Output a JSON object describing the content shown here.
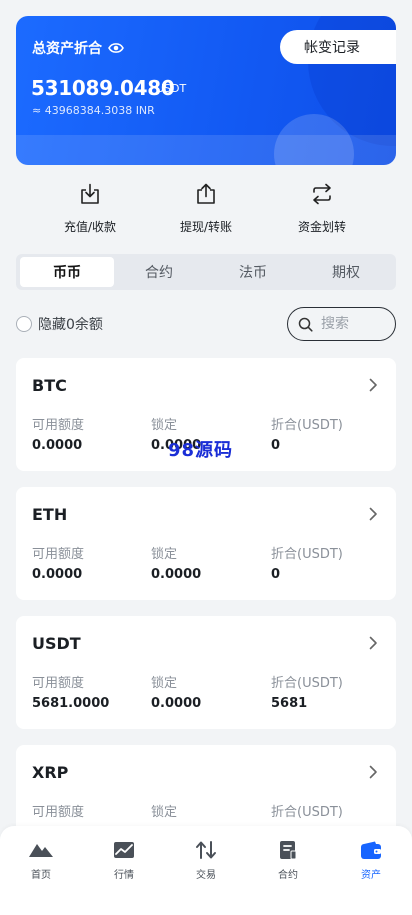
{
  "header": {
    "title": "总资产折合",
    "record_button": "帐变记录",
    "balance": "531089.0480",
    "balance_unit": "USDT",
    "converted": "≈ 43968384.3038 INR",
    "accent_color": "#1765ff"
  },
  "actions": [
    {
      "label": "充值/收款",
      "icon": "download-icon"
    },
    {
      "label": "提现/转账",
      "icon": "upload-icon"
    },
    {
      "label": "资金划转",
      "icon": "transfer-icon"
    }
  ],
  "tabs": [
    {
      "label": "币币",
      "active": true
    },
    {
      "label": "合约",
      "active": false
    },
    {
      "label": "法币",
      "active": false
    },
    {
      "label": "期权",
      "active": false
    }
  ],
  "filter": {
    "hide_zero_label": "隐藏0余额",
    "search_placeholder": "搜索"
  },
  "columns": [
    "可用额度",
    "锁定",
    "折合(USDT)"
  ],
  "assets": [
    {
      "coin": "BTC",
      "available": "0.0000",
      "locked": "0.0000",
      "converted": "0"
    },
    {
      "coin": "ETH",
      "available": "0.0000",
      "locked": "0.0000",
      "converted": "0"
    },
    {
      "coin": "USDT",
      "available": "5681.0000",
      "locked": "0.0000",
      "converted": "5681"
    },
    {
      "coin": "XRP",
      "available": "",
      "locked": "",
      "converted": ""
    }
  ],
  "watermark": "98源码",
  "bottom_nav": [
    {
      "label": "首页",
      "icon": "home-mountain-icon",
      "active": false
    },
    {
      "label": "行情",
      "icon": "market-chart-icon",
      "active": false
    },
    {
      "label": "交易",
      "icon": "trade-arrows-icon",
      "active": false
    },
    {
      "label": "合约",
      "icon": "contract-doc-icon",
      "active": false
    },
    {
      "label": "资产",
      "icon": "wallet-icon",
      "active": true
    }
  ]
}
